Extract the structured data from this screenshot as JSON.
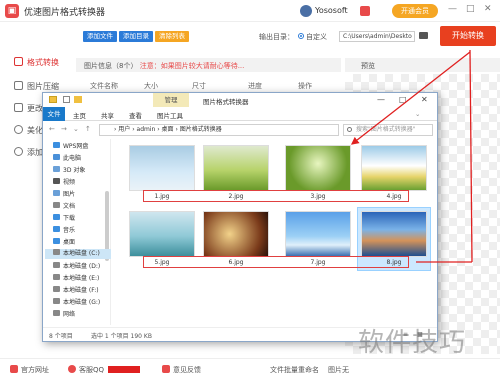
{
  "app": {
    "title": "优速图片格式转换器",
    "username": "Yososoft",
    "vip_label": "开通会员",
    "min_icon": "—",
    "max_icon": "□",
    "close_icon": "✕"
  },
  "sidebar": {
    "items": [
      {
        "label": "格式转换",
        "icon": "convert-icon",
        "active": true
      },
      {
        "label": "图片压缩",
        "icon": "compress-icon"
      },
      {
        "label": "更改",
        "icon": "resize-icon"
      },
      {
        "label": "美化",
        "icon": "beautify-icon"
      },
      {
        "label": "添加",
        "icon": "add-icon"
      }
    ]
  },
  "toolbar": {
    "add_file": "添加文件",
    "add_dir": "添加目录",
    "clear_list": "清除列表",
    "output_label": "输出目录：",
    "custom_label": "自定义",
    "output_path": "C:\\Users\\admin\\Deskto",
    "start_label": "开始转换"
  },
  "filelist": {
    "header_info": "图片信息（8个）",
    "warning": "注意：如果图片较大请耐心等待...",
    "columns": [
      "文件名称",
      "大小",
      "尺寸",
      "进度",
      "操作"
    ]
  },
  "preview": {
    "label": "预览"
  },
  "footer": {
    "website": "官方网址",
    "qq": "客服QQ",
    "feedback": "意见反馈",
    "batch_rename": "文件批量重命名",
    "img_more": "图片无"
  },
  "explorer": {
    "manage_tab": "管理",
    "title": "图片格式转换器",
    "tabs": [
      "文件",
      "主页",
      "共享",
      "查看",
      "图片工具"
    ],
    "breadcrumb": "› 用户 › admin › 桌面 › 图片格式转换器",
    "search_placeholder": "搜索\"图片格式转换器\"",
    "nav": [
      {
        "label": "WPS网盘",
        "color": "#3b8fe0"
      },
      {
        "label": "此电脑",
        "color": "#4a90d9"
      },
      {
        "label": "3D 对象",
        "color": "#6aa0d8"
      },
      {
        "label": "视频",
        "color": "#555"
      },
      {
        "label": "图片",
        "color": "#6aa0d8"
      },
      {
        "label": "文档",
        "color": "#888"
      },
      {
        "label": "下载",
        "color": "#3b8fe0"
      },
      {
        "label": "音乐",
        "color": "#3b8fe0"
      },
      {
        "label": "桌面",
        "color": "#3b8fe0"
      },
      {
        "label": "本地磁盘 (C:)",
        "color": "#888",
        "selected": true
      },
      {
        "label": "本地磁盘 (D:)",
        "color": "#888"
      },
      {
        "label": "本地磁盘 (E:)",
        "color": "#888"
      },
      {
        "label": "本地磁盘 (F:)",
        "color": "#888"
      },
      {
        "label": "本地磁盘 (G:)",
        "color": "#888"
      },
      {
        "label": "网络",
        "color": "#888"
      }
    ],
    "files": [
      {
        "name": "1.jpg"
      },
      {
        "name": "2.jpg"
      },
      {
        "name": "3.jpg"
      },
      {
        "name": "4.jpg"
      },
      {
        "name": "5.jpg"
      },
      {
        "name": "6.jpg"
      },
      {
        "name": "7.jpg"
      },
      {
        "name": "8.jpg",
        "selected": true
      }
    ],
    "status_count": "8 个项目",
    "status_selected": "选中 1 个项目  190 KB"
  },
  "watermark": "软件技巧"
}
